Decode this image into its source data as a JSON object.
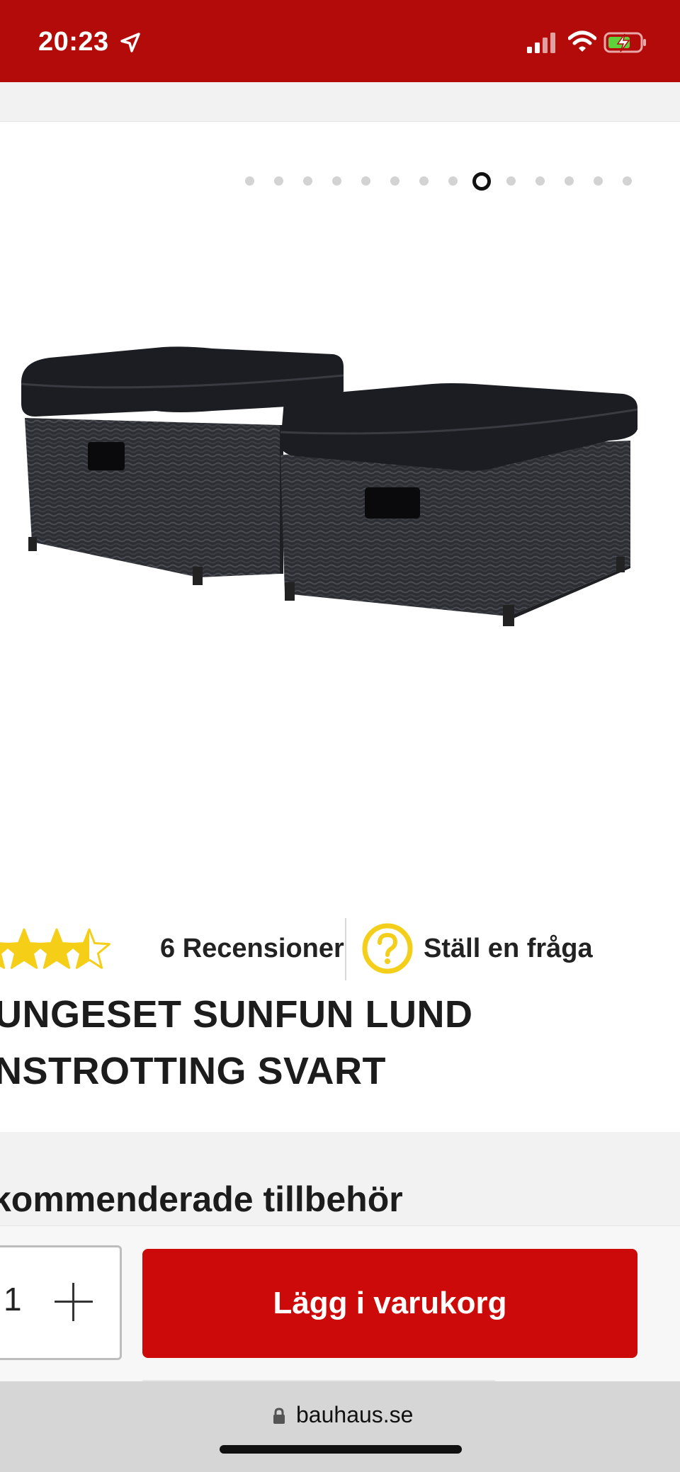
{
  "status_bar": {
    "time": "20:23",
    "background_color": "#b30a0a"
  },
  "carousel": {
    "total_images": 14,
    "active_index": 8
  },
  "product": {
    "rating": 3.5,
    "max_rating": 5,
    "review_count_label": "6 Recensioner",
    "ask_question_label": "Ställ en fråga",
    "title_lines": [
      "UNGESET SUNFUN LUND",
      "NSTROTTING SVART"
    ]
  },
  "accessories": {
    "heading": "kommenderade tillbehör"
  },
  "cart": {
    "quantity": "1",
    "add_button_label": "Lägg i varukorg",
    "button_color": "#cc0a0a"
  },
  "browser": {
    "url": "bauhaus.se"
  }
}
